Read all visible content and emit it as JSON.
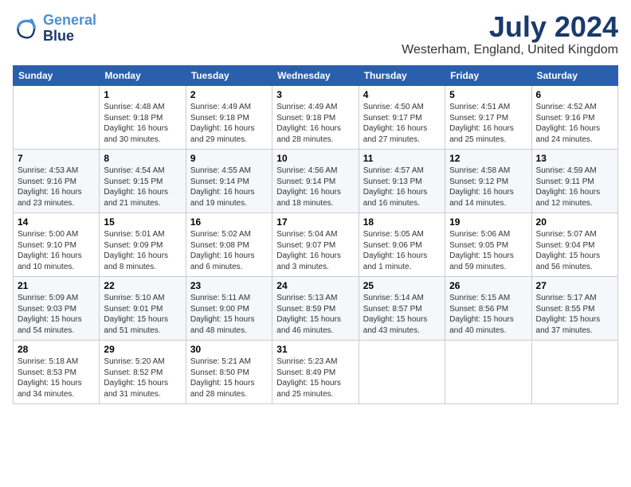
{
  "header": {
    "logo_line1": "General",
    "logo_line2": "Blue",
    "month": "July 2024",
    "location": "Westerham, England, United Kingdom"
  },
  "weekdays": [
    "Sunday",
    "Monday",
    "Tuesday",
    "Wednesday",
    "Thursday",
    "Friday",
    "Saturday"
  ],
  "weeks": [
    [
      {
        "day": "",
        "details": ""
      },
      {
        "day": "1",
        "details": "Sunrise: 4:48 AM\nSunset: 9:18 PM\nDaylight: 16 hours\nand 30 minutes."
      },
      {
        "day": "2",
        "details": "Sunrise: 4:49 AM\nSunset: 9:18 PM\nDaylight: 16 hours\nand 29 minutes."
      },
      {
        "day": "3",
        "details": "Sunrise: 4:49 AM\nSunset: 9:18 PM\nDaylight: 16 hours\nand 28 minutes."
      },
      {
        "day": "4",
        "details": "Sunrise: 4:50 AM\nSunset: 9:17 PM\nDaylight: 16 hours\nand 27 minutes."
      },
      {
        "day": "5",
        "details": "Sunrise: 4:51 AM\nSunset: 9:17 PM\nDaylight: 16 hours\nand 25 minutes."
      },
      {
        "day": "6",
        "details": "Sunrise: 4:52 AM\nSunset: 9:16 PM\nDaylight: 16 hours\nand 24 minutes."
      }
    ],
    [
      {
        "day": "7",
        "details": "Sunrise: 4:53 AM\nSunset: 9:16 PM\nDaylight: 16 hours\nand 23 minutes."
      },
      {
        "day": "8",
        "details": "Sunrise: 4:54 AM\nSunset: 9:15 PM\nDaylight: 16 hours\nand 21 minutes."
      },
      {
        "day": "9",
        "details": "Sunrise: 4:55 AM\nSunset: 9:14 PM\nDaylight: 16 hours\nand 19 minutes."
      },
      {
        "day": "10",
        "details": "Sunrise: 4:56 AM\nSunset: 9:14 PM\nDaylight: 16 hours\nand 18 minutes."
      },
      {
        "day": "11",
        "details": "Sunrise: 4:57 AM\nSunset: 9:13 PM\nDaylight: 16 hours\nand 16 minutes."
      },
      {
        "day": "12",
        "details": "Sunrise: 4:58 AM\nSunset: 9:12 PM\nDaylight: 16 hours\nand 14 minutes."
      },
      {
        "day": "13",
        "details": "Sunrise: 4:59 AM\nSunset: 9:11 PM\nDaylight: 16 hours\nand 12 minutes."
      }
    ],
    [
      {
        "day": "14",
        "details": "Sunrise: 5:00 AM\nSunset: 9:10 PM\nDaylight: 16 hours\nand 10 minutes."
      },
      {
        "day": "15",
        "details": "Sunrise: 5:01 AM\nSunset: 9:09 PM\nDaylight: 16 hours\nand 8 minutes."
      },
      {
        "day": "16",
        "details": "Sunrise: 5:02 AM\nSunset: 9:08 PM\nDaylight: 16 hours\nand 6 minutes."
      },
      {
        "day": "17",
        "details": "Sunrise: 5:04 AM\nSunset: 9:07 PM\nDaylight: 16 hours\nand 3 minutes."
      },
      {
        "day": "18",
        "details": "Sunrise: 5:05 AM\nSunset: 9:06 PM\nDaylight: 16 hours\nand 1 minute."
      },
      {
        "day": "19",
        "details": "Sunrise: 5:06 AM\nSunset: 9:05 PM\nDaylight: 15 hours\nand 59 minutes."
      },
      {
        "day": "20",
        "details": "Sunrise: 5:07 AM\nSunset: 9:04 PM\nDaylight: 15 hours\nand 56 minutes."
      }
    ],
    [
      {
        "day": "21",
        "details": "Sunrise: 5:09 AM\nSunset: 9:03 PM\nDaylight: 15 hours\nand 54 minutes."
      },
      {
        "day": "22",
        "details": "Sunrise: 5:10 AM\nSunset: 9:01 PM\nDaylight: 15 hours\nand 51 minutes."
      },
      {
        "day": "23",
        "details": "Sunrise: 5:11 AM\nSunset: 9:00 PM\nDaylight: 15 hours\nand 48 minutes."
      },
      {
        "day": "24",
        "details": "Sunrise: 5:13 AM\nSunset: 8:59 PM\nDaylight: 15 hours\nand 46 minutes."
      },
      {
        "day": "25",
        "details": "Sunrise: 5:14 AM\nSunset: 8:57 PM\nDaylight: 15 hours\nand 43 minutes."
      },
      {
        "day": "26",
        "details": "Sunrise: 5:15 AM\nSunset: 8:56 PM\nDaylight: 15 hours\nand 40 minutes."
      },
      {
        "day": "27",
        "details": "Sunrise: 5:17 AM\nSunset: 8:55 PM\nDaylight: 15 hours\nand 37 minutes."
      }
    ],
    [
      {
        "day": "28",
        "details": "Sunrise: 5:18 AM\nSunset: 8:53 PM\nDaylight: 15 hours\nand 34 minutes."
      },
      {
        "day": "29",
        "details": "Sunrise: 5:20 AM\nSunset: 8:52 PM\nDaylight: 15 hours\nand 31 minutes."
      },
      {
        "day": "30",
        "details": "Sunrise: 5:21 AM\nSunset: 8:50 PM\nDaylight: 15 hours\nand 28 minutes."
      },
      {
        "day": "31",
        "details": "Sunrise: 5:23 AM\nSunset: 8:49 PM\nDaylight: 15 hours\nand 25 minutes."
      },
      {
        "day": "",
        "details": ""
      },
      {
        "day": "",
        "details": ""
      },
      {
        "day": "",
        "details": ""
      }
    ]
  ]
}
